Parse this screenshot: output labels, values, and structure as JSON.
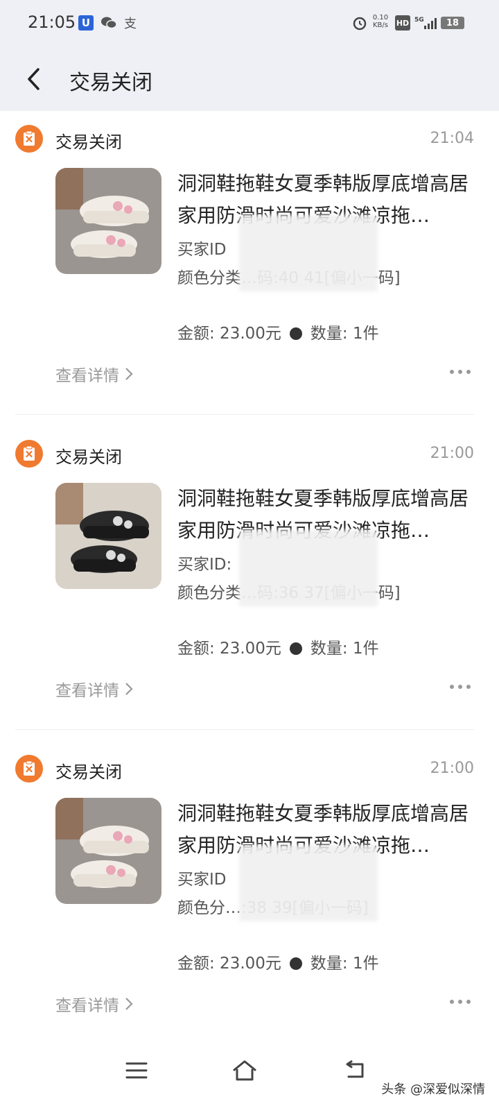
{
  "status_bar": {
    "time": "21:05",
    "app_icon_u": "U",
    "alipay_glyph": "支",
    "net_speed_value": "0.10",
    "net_speed_unit": "KB/s",
    "hd_label": "HD",
    "network_label": "5G",
    "battery_level": "18"
  },
  "header": {
    "title": "交易关闭"
  },
  "orders": [
    {
      "status": "交易关闭",
      "time": "21:04",
      "title": "洞洞鞋拖鞋女夏季韩版厚底增高居家用防滑时尚可爱沙滩凉拖…",
      "buyer_id": "买家ID",
      "color_class": "颜色分类…码:40 41[偏小一码]",
      "amount": "金额: 23.00元",
      "quantity": "数量: 1件",
      "details_link": "查看详情",
      "thumb_color": "white"
    },
    {
      "status": "交易关闭",
      "time": "21:00",
      "title": "洞洞鞋拖鞋女夏季韩版厚底增高居家用防滑时尚可爱沙滩凉拖…",
      "buyer_id": "买家ID:",
      "color_class": "颜色分类…码:36 37[偏小一码]",
      "amount": "金额: 23.00元",
      "quantity": "数量: 1件",
      "details_link": "查看详情",
      "thumb_color": "black"
    },
    {
      "status": "交易关闭",
      "time": "21:00",
      "title": "洞洞鞋拖鞋女夏季韩版厚底增高居家用防滑时尚可爱沙滩凉拖…",
      "buyer_id": "买家ID",
      "color_class": "颜色分…:38 39[偏小一码]",
      "amount": "金额: 23.00元",
      "quantity": "数量: 1件",
      "details_link": "查看详情",
      "thumb_color": "white"
    }
  ],
  "watermark": "头条 @深爱似深情",
  "colors": {
    "status_icon": "#f07a2f",
    "bar_bg": "#eef0f5",
    "muted": "#999999"
  }
}
